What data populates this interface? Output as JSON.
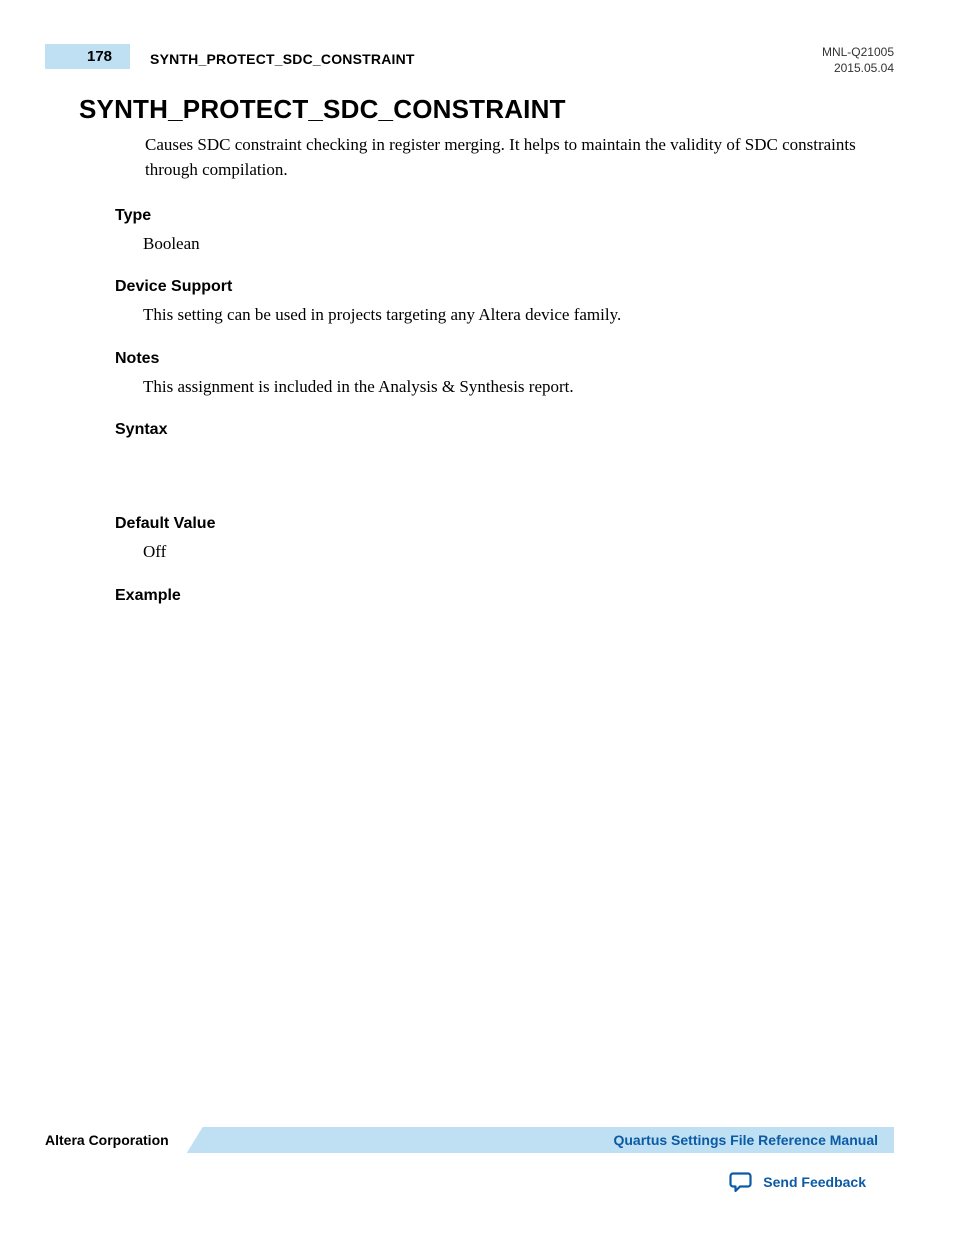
{
  "header": {
    "page_number": "178",
    "topic": "SYNTH_PROTECT_SDC_CONSTRAINT",
    "doc_id": "MNL-Q21005",
    "date": "2015.05.04"
  },
  "title": "SYNTH_PROTECT_SDC_CONSTRAINT",
  "intro": "Causes SDC constraint checking in register merging. It helps to maintain the validity of SDC constraints through compilation.",
  "sections": {
    "type": {
      "heading": "Type",
      "body": "Boolean"
    },
    "device_support": {
      "heading": "Device Support",
      "body": "This setting can be used in projects targeting any Altera device family."
    },
    "notes": {
      "heading": "Notes",
      "body": "This assignment is included in the Analysis & Synthesis report."
    },
    "syntax": {
      "heading": "Syntax",
      "body": ""
    },
    "default_value": {
      "heading": "Default Value",
      "body": "Off"
    },
    "example": {
      "heading": "Example",
      "body": ""
    }
  },
  "footer": {
    "company": "Altera Corporation",
    "manual_link": "Quartus Settings File Reference Manual",
    "feedback": "Send Feedback"
  }
}
